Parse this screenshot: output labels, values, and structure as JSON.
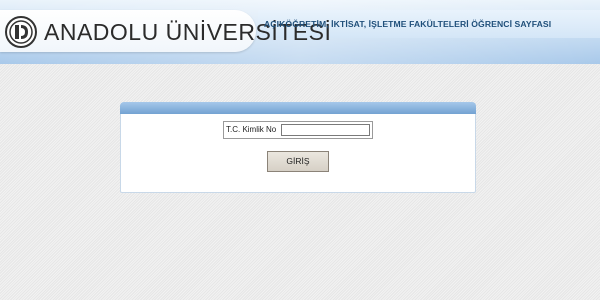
{
  "header": {
    "logo_text": "ANADOLU ÜNİVERSİTESİ",
    "subtitle": "AÇIKÖĞRETİM, İKTİSAT, İŞLETME FAKÜLTELERİ ÖĞRENCİ SAYFASI",
    "logo_icon": "anadolu-university-emblem",
    "accent_color": "#1f4f7a",
    "header_color": "#c5dcf2"
  },
  "login": {
    "id_label": "T.C. Kimlik No",
    "id_value": "",
    "submit_label": "GİRİŞ",
    "panel_color": "#6f9fd0"
  }
}
